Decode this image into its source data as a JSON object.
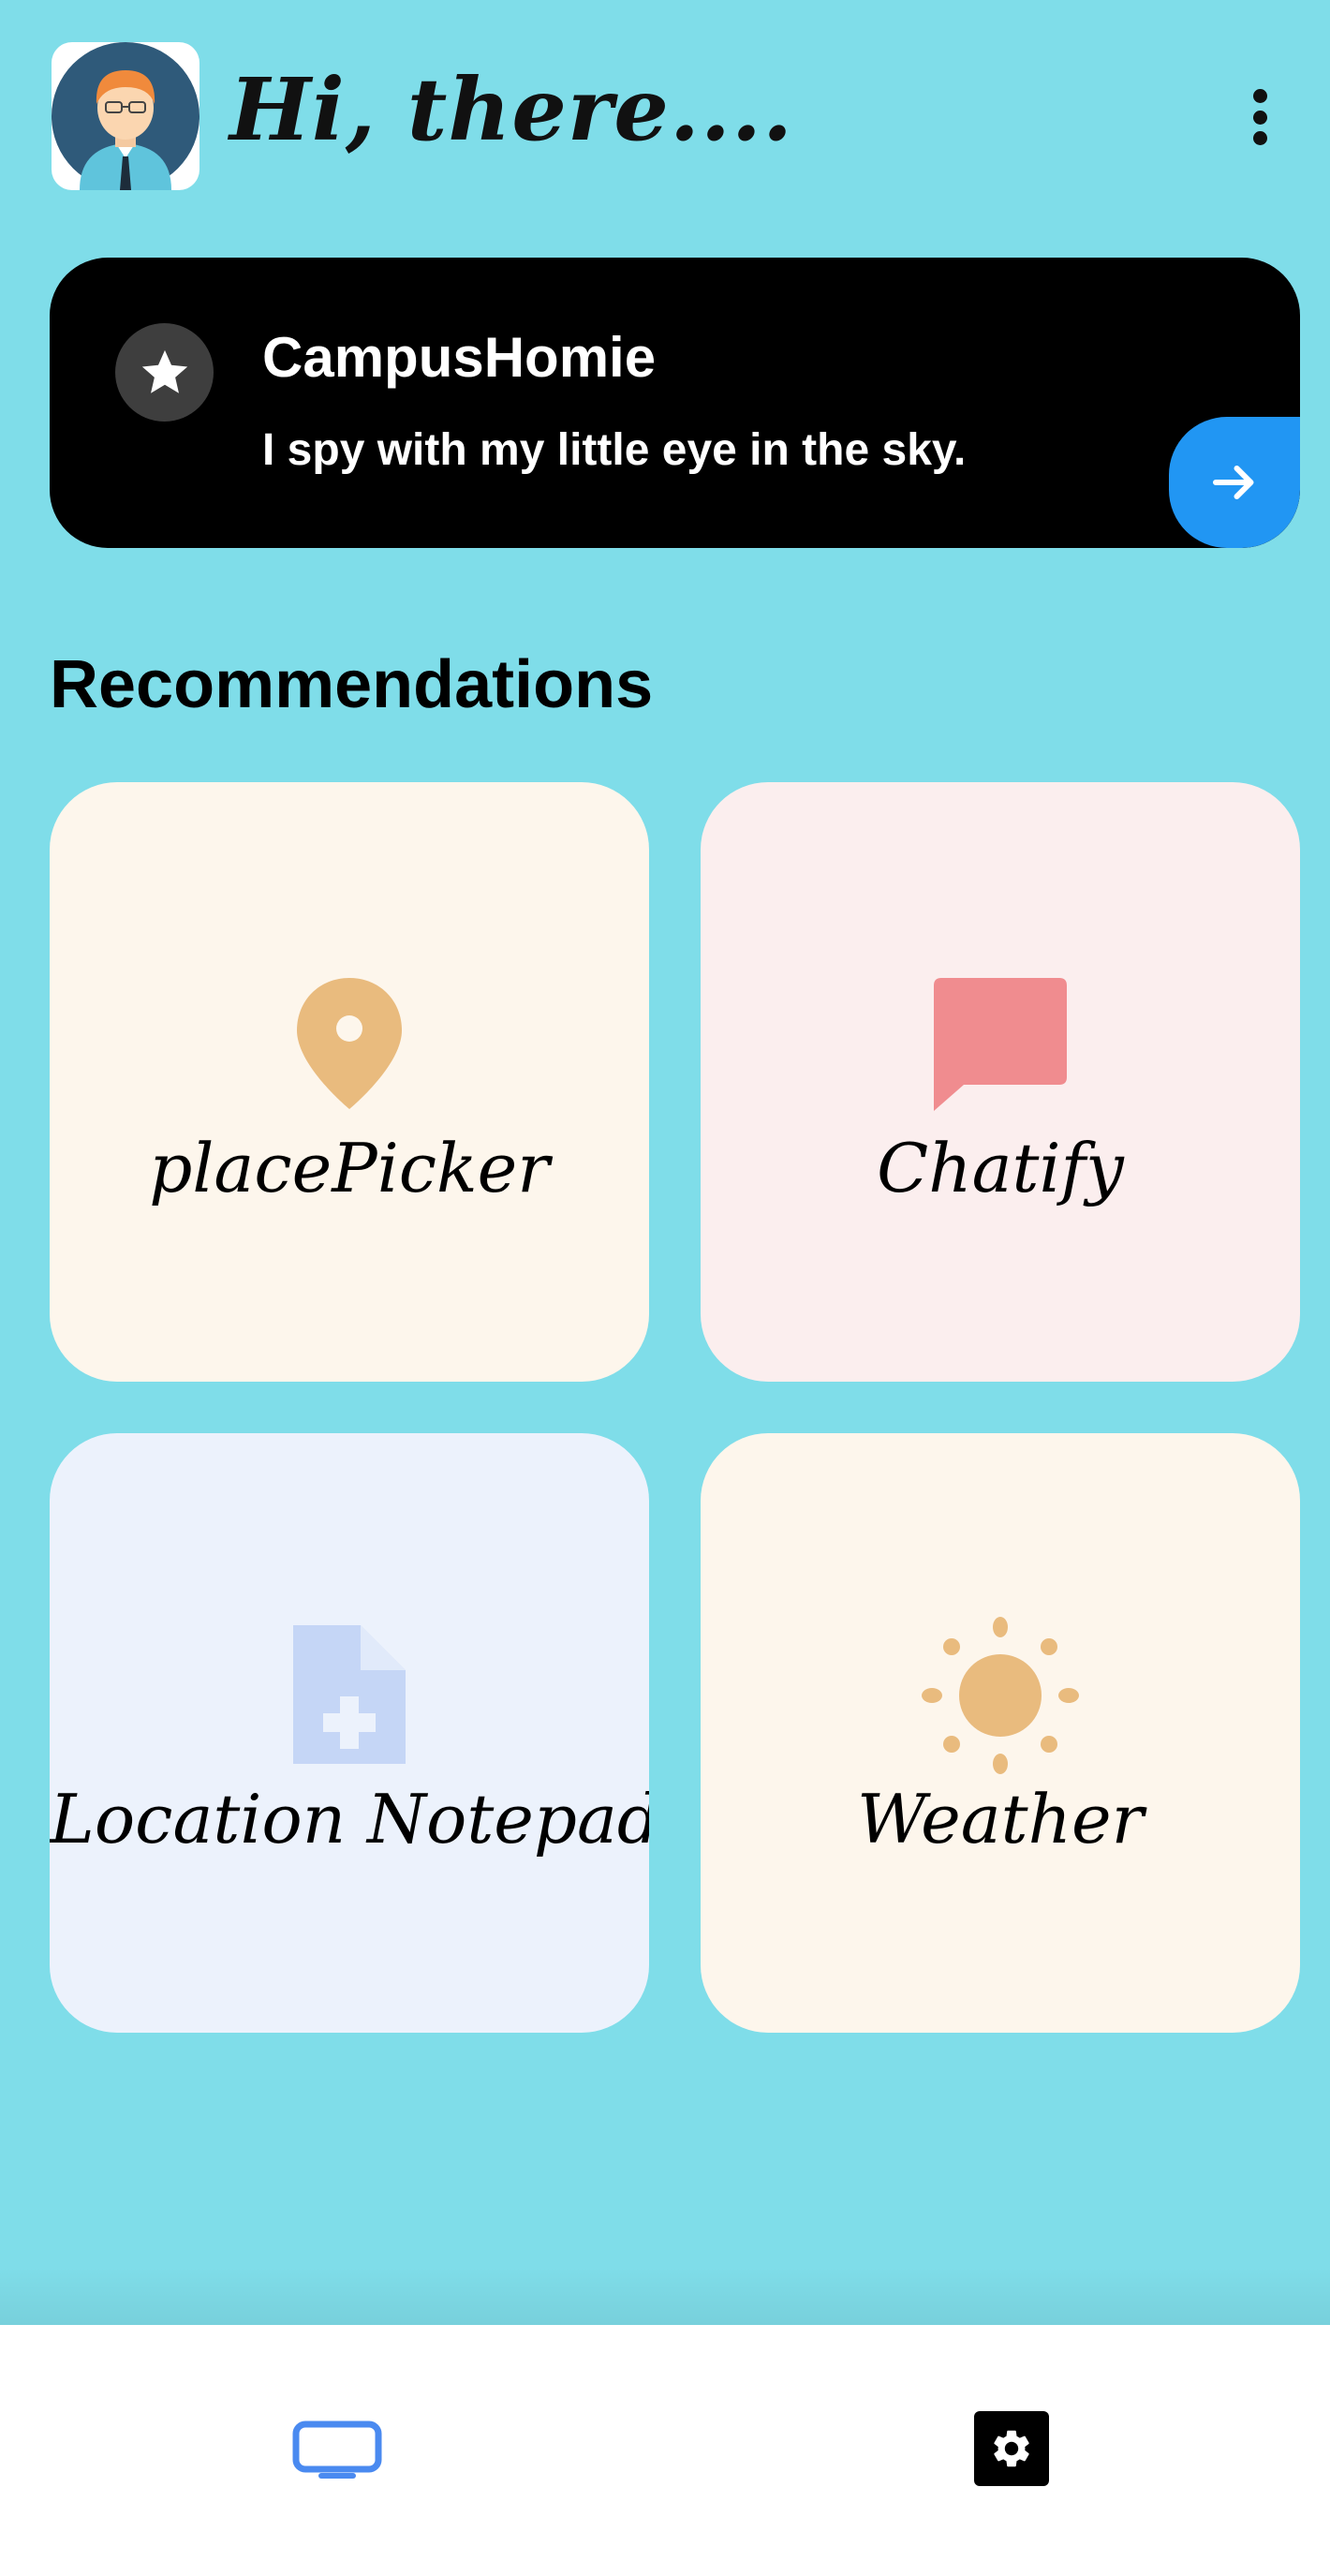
{
  "header": {
    "greeting": "Hi, there....",
    "avatar_icon": "user-avatar-icon",
    "menu_icon": "more-vert-icon"
  },
  "banner": {
    "title": "CampusHomie",
    "subtitle": "I spy with my little eye in the sky.",
    "icon": "star-icon",
    "action_icon": "arrow-right-icon"
  },
  "recommendations": {
    "title": "Recommendations",
    "items": [
      {
        "label": "placePicker",
        "icon": "location-pin-icon",
        "background": "#fdf6ec",
        "icon_color": "#e9bb7e"
      },
      {
        "label": "Chatify",
        "icon": "chat-bubble-icon",
        "background": "#fbeeee",
        "icon_color": "#f08c8f"
      },
      {
        "label": "Location Notepad",
        "icon": "note-add-icon",
        "background": "#ecf2fc",
        "icon_color": "#c5d6f6"
      },
      {
        "label": "Weather",
        "icon": "sun-icon",
        "background": "#fdf6ec",
        "icon_color": "#e9bb7e"
      }
    ]
  },
  "bottom_nav": {
    "items": [
      {
        "icon": "tv-icon",
        "color": "#4a8af0"
      },
      {
        "icon": "settings-icon",
        "color": "#000000"
      }
    ]
  },
  "colors": {
    "background": "#7fdde9",
    "banner": "#000000",
    "accent": "#2196f3"
  }
}
